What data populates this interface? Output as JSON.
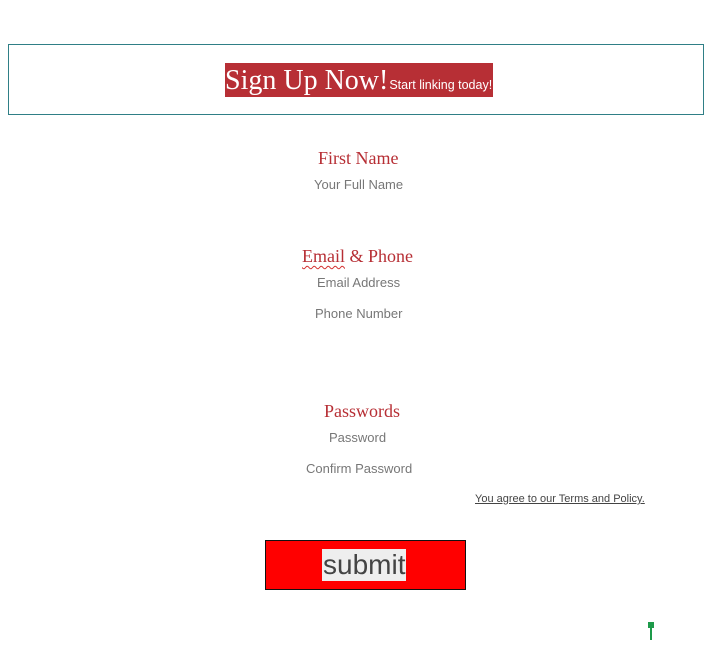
{
  "header": {
    "title": "Sign Up Now!",
    "subtitle": "Start linking today!"
  },
  "sections": {
    "name": {
      "title": "First Name",
      "field_placeholder": "Your Full Name"
    },
    "contact": {
      "title_word1": "Email",
      "title_rest": " & Phone",
      "email_placeholder": "Email Address",
      "phone_placeholder": "Phone Number"
    },
    "passwords": {
      "title": "Passwords",
      "password_placeholder": "Password",
      "confirm_placeholder": "Confirm Password"
    }
  },
  "terms": {
    "label": "You agree to our Terms and Policy."
  },
  "submit": {
    "label": "submit"
  },
  "colors": {
    "accent": "#b72f35",
    "button": "#ff0000",
    "header_border": "#2f7f86"
  }
}
